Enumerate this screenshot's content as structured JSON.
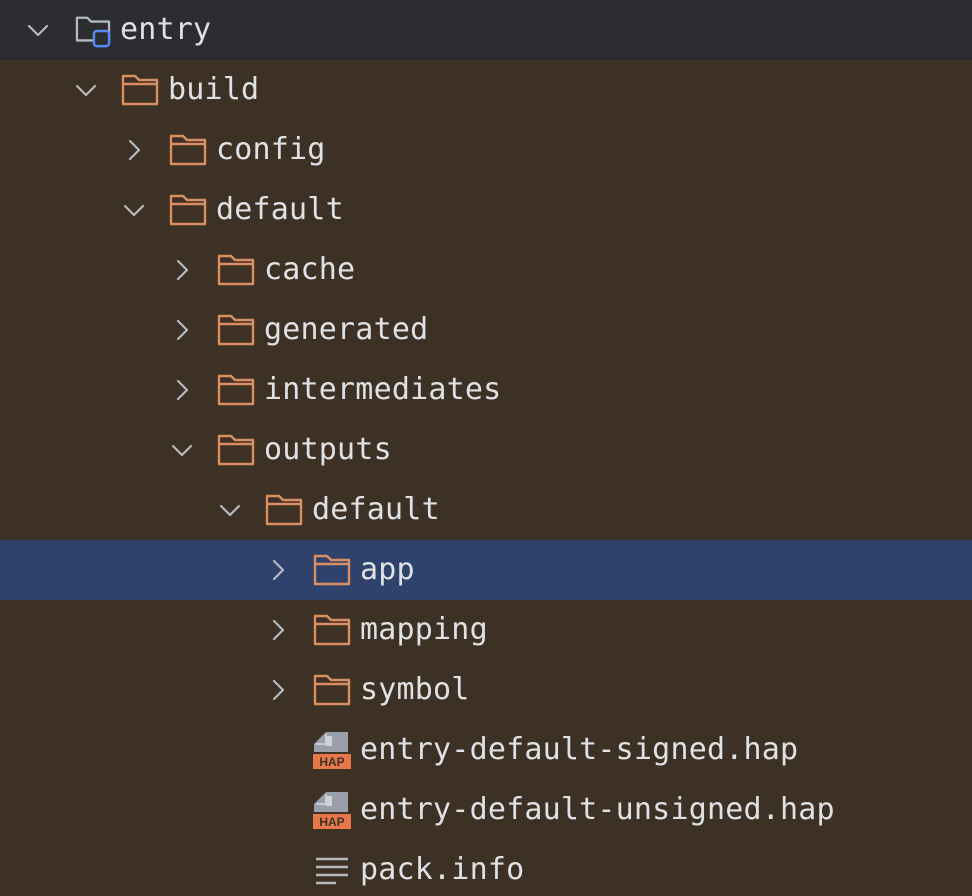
{
  "colors": {
    "folder_stroke": "#d98f63",
    "module_folder_stroke": "#b5b9c1",
    "module_badge": "#548af7",
    "selection": "#2f426b",
    "build_background": "#3d3125",
    "text": "#dfe1e5",
    "chevron": "#b5b9c1",
    "hap_icon_accent": "#e8784a"
  },
  "tree": {
    "rows": [
      {
        "label": "entry",
        "icon": "module-folder-icon",
        "chevron": "chevron-down-icon"
      },
      {
        "label": "build",
        "icon": "folder-icon",
        "chevron": "chevron-down-icon"
      },
      {
        "label": "config",
        "icon": "folder-icon",
        "chevron": "chevron-right-icon"
      },
      {
        "label": "default",
        "icon": "folder-icon",
        "chevron": "chevron-down-icon"
      },
      {
        "label": "cache",
        "icon": "folder-icon",
        "chevron": "chevron-right-icon"
      },
      {
        "label": "generated",
        "icon": "folder-icon",
        "chevron": "chevron-right-icon"
      },
      {
        "label": "intermediates",
        "icon": "folder-icon",
        "chevron": "chevron-right-icon"
      },
      {
        "label": "outputs",
        "icon": "folder-icon",
        "chevron": "chevron-down-icon"
      },
      {
        "label": "default",
        "icon": "folder-icon",
        "chevron": "chevron-down-icon"
      },
      {
        "label": "app",
        "icon": "folder-icon",
        "chevron": "chevron-right-icon",
        "selected": true
      },
      {
        "label": "mapping",
        "icon": "folder-icon",
        "chevron": "chevron-right-icon"
      },
      {
        "label": "symbol",
        "icon": "folder-icon",
        "chevron": "chevron-right-icon"
      },
      {
        "label": "entry-default-signed.hap",
        "icon": "hap-file-icon",
        "icon_text": "HAP"
      },
      {
        "label": "entry-default-unsigned.hap",
        "icon": "hap-file-icon",
        "icon_text": "HAP"
      },
      {
        "label": "pack.info",
        "icon": "text-file-icon"
      }
    ]
  }
}
